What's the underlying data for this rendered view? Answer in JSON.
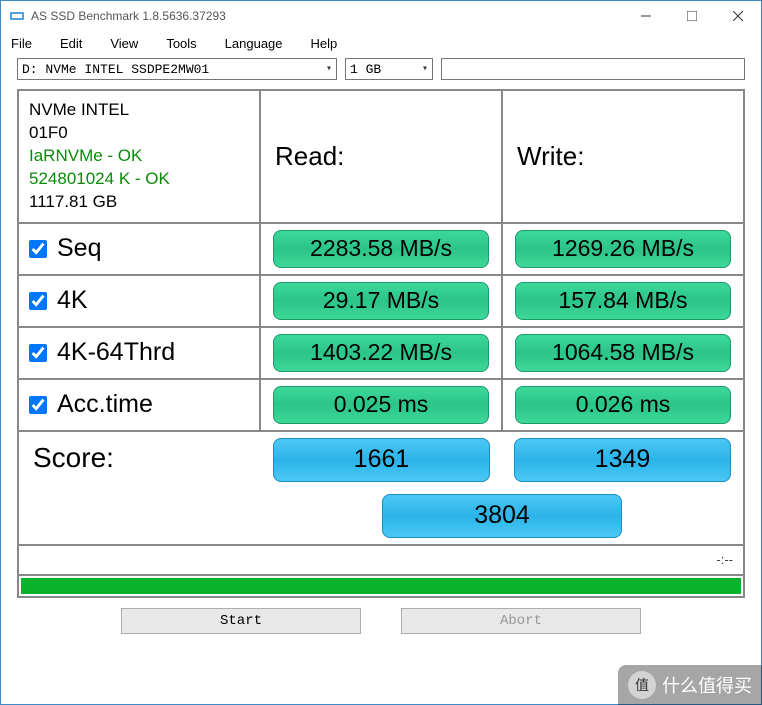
{
  "window": {
    "title": "AS SSD Benchmark 1.8.5636.37293"
  },
  "menu": {
    "file": "File",
    "edit": "Edit",
    "view": "View",
    "tools": "Tools",
    "language": "Language",
    "help": "Help"
  },
  "toolbar": {
    "drive": "D: NVMe INTEL SSDPE2MW01",
    "size": "1 GB"
  },
  "info": {
    "model": "NVMe INTEL",
    "firmware": "01F0",
    "driver": "IaRNVMe - OK",
    "partition": "524801024 K - OK",
    "capacity": "1117.81 GB"
  },
  "headers": {
    "read": "Read:",
    "write": "Write:",
    "score": "Score:"
  },
  "tests": {
    "seq": {
      "label": "Seq",
      "read": "2283.58 MB/s",
      "write": "1269.26 MB/s"
    },
    "fourk": {
      "label": "4K",
      "read": "29.17 MB/s",
      "write": "157.84 MB/s"
    },
    "fourk64": {
      "label": "4K-64Thrd",
      "read": "1403.22 MB/s",
      "write": "1064.58 MB/s"
    },
    "acc": {
      "label": "Acc.time",
      "read": "0.025 ms",
      "write": "0.026 ms"
    }
  },
  "scores": {
    "read": "1661",
    "write": "1349",
    "total": "3804"
  },
  "status": "-:--",
  "buttons": {
    "start": "Start",
    "abort": "Abort"
  },
  "watermark": "什么值得买",
  "watermark_badge": "值"
}
